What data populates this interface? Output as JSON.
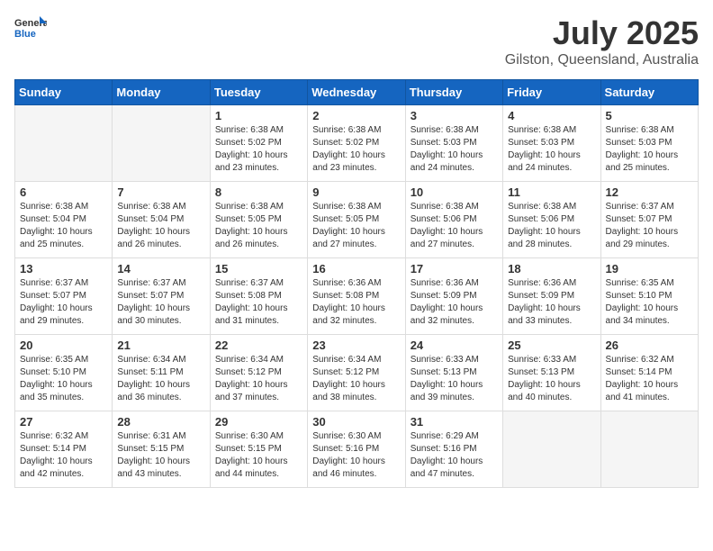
{
  "header": {
    "logo": {
      "line1": "General",
      "line2": "Blue"
    },
    "title": "July 2025",
    "location": "Gilston, Queensland, Australia"
  },
  "weekdays": [
    "Sunday",
    "Monday",
    "Tuesday",
    "Wednesday",
    "Thursday",
    "Friday",
    "Saturday"
  ],
  "weeks": [
    [
      {
        "day": null
      },
      {
        "day": null
      },
      {
        "day": "1",
        "sunrise": "6:38 AM",
        "sunset": "5:02 PM",
        "daylight": "10 hours and 23 minutes."
      },
      {
        "day": "2",
        "sunrise": "6:38 AM",
        "sunset": "5:02 PM",
        "daylight": "10 hours and 23 minutes."
      },
      {
        "day": "3",
        "sunrise": "6:38 AM",
        "sunset": "5:03 PM",
        "daylight": "10 hours and 24 minutes."
      },
      {
        "day": "4",
        "sunrise": "6:38 AM",
        "sunset": "5:03 PM",
        "daylight": "10 hours and 24 minutes."
      },
      {
        "day": "5",
        "sunrise": "6:38 AM",
        "sunset": "5:03 PM",
        "daylight": "10 hours and 25 minutes."
      }
    ],
    [
      {
        "day": "6",
        "sunrise": "6:38 AM",
        "sunset": "5:04 PM",
        "daylight": "10 hours and 25 minutes."
      },
      {
        "day": "7",
        "sunrise": "6:38 AM",
        "sunset": "5:04 PM",
        "daylight": "10 hours and 26 minutes."
      },
      {
        "day": "8",
        "sunrise": "6:38 AM",
        "sunset": "5:05 PM",
        "daylight": "10 hours and 26 minutes."
      },
      {
        "day": "9",
        "sunrise": "6:38 AM",
        "sunset": "5:05 PM",
        "daylight": "10 hours and 27 minutes."
      },
      {
        "day": "10",
        "sunrise": "6:38 AM",
        "sunset": "5:06 PM",
        "daylight": "10 hours and 27 minutes."
      },
      {
        "day": "11",
        "sunrise": "6:38 AM",
        "sunset": "5:06 PM",
        "daylight": "10 hours and 28 minutes."
      },
      {
        "day": "12",
        "sunrise": "6:37 AM",
        "sunset": "5:07 PM",
        "daylight": "10 hours and 29 minutes."
      }
    ],
    [
      {
        "day": "13",
        "sunrise": "6:37 AM",
        "sunset": "5:07 PM",
        "daylight": "10 hours and 29 minutes."
      },
      {
        "day": "14",
        "sunrise": "6:37 AM",
        "sunset": "5:07 PM",
        "daylight": "10 hours and 30 minutes."
      },
      {
        "day": "15",
        "sunrise": "6:37 AM",
        "sunset": "5:08 PM",
        "daylight": "10 hours and 31 minutes."
      },
      {
        "day": "16",
        "sunrise": "6:36 AM",
        "sunset": "5:08 PM",
        "daylight": "10 hours and 32 minutes."
      },
      {
        "day": "17",
        "sunrise": "6:36 AM",
        "sunset": "5:09 PM",
        "daylight": "10 hours and 32 minutes."
      },
      {
        "day": "18",
        "sunrise": "6:36 AM",
        "sunset": "5:09 PM",
        "daylight": "10 hours and 33 minutes."
      },
      {
        "day": "19",
        "sunrise": "6:35 AM",
        "sunset": "5:10 PM",
        "daylight": "10 hours and 34 minutes."
      }
    ],
    [
      {
        "day": "20",
        "sunrise": "6:35 AM",
        "sunset": "5:10 PM",
        "daylight": "10 hours and 35 minutes."
      },
      {
        "day": "21",
        "sunrise": "6:34 AM",
        "sunset": "5:11 PM",
        "daylight": "10 hours and 36 minutes."
      },
      {
        "day": "22",
        "sunrise": "6:34 AM",
        "sunset": "5:12 PM",
        "daylight": "10 hours and 37 minutes."
      },
      {
        "day": "23",
        "sunrise": "6:34 AM",
        "sunset": "5:12 PM",
        "daylight": "10 hours and 38 minutes."
      },
      {
        "day": "24",
        "sunrise": "6:33 AM",
        "sunset": "5:13 PM",
        "daylight": "10 hours and 39 minutes."
      },
      {
        "day": "25",
        "sunrise": "6:33 AM",
        "sunset": "5:13 PM",
        "daylight": "10 hours and 40 minutes."
      },
      {
        "day": "26",
        "sunrise": "6:32 AM",
        "sunset": "5:14 PM",
        "daylight": "10 hours and 41 minutes."
      }
    ],
    [
      {
        "day": "27",
        "sunrise": "6:32 AM",
        "sunset": "5:14 PM",
        "daylight": "10 hours and 42 minutes."
      },
      {
        "day": "28",
        "sunrise": "6:31 AM",
        "sunset": "5:15 PM",
        "daylight": "10 hours and 43 minutes."
      },
      {
        "day": "29",
        "sunrise": "6:30 AM",
        "sunset": "5:15 PM",
        "daylight": "10 hours and 44 minutes."
      },
      {
        "day": "30",
        "sunrise": "6:30 AM",
        "sunset": "5:16 PM",
        "daylight": "10 hours and 46 minutes."
      },
      {
        "day": "31",
        "sunrise": "6:29 AM",
        "sunset": "5:16 PM",
        "daylight": "10 hours and 47 minutes."
      },
      {
        "day": null
      },
      {
        "day": null
      }
    ]
  ]
}
